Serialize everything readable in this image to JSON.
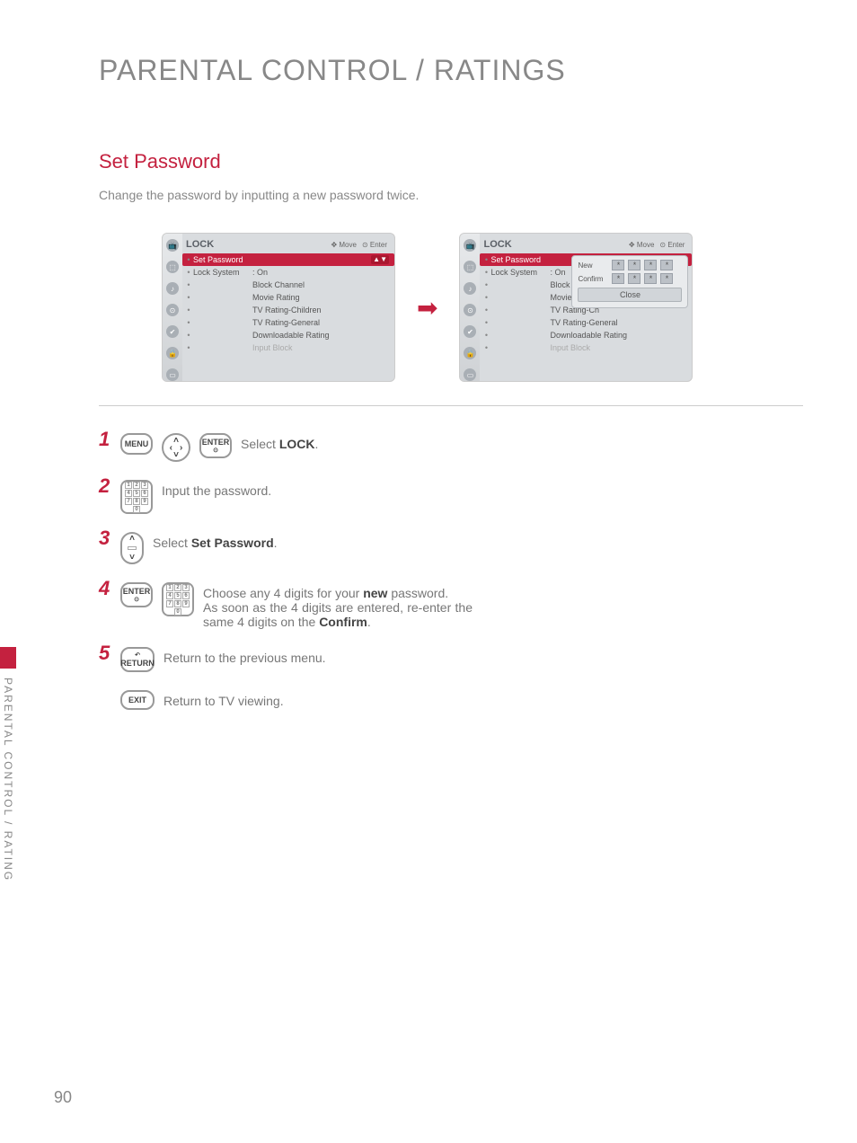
{
  "page": {
    "title": "PARENTAL CONTROL / RATINGS",
    "section_title": "Set Password",
    "section_desc": "Change the password by inputting a new password twice.",
    "number": "90",
    "side_label": "PARENTAL CONTROL / RATING"
  },
  "screen": {
    "header_title": "LOCK",
    "header_move": "Move",
    "header_enter": "Enter",
    "items": {
      "set_password": "Set Password",
      "lock_system_label": "Lock System",
      "lock_system_value": ": On",
      "block_channel": "Block Channel",
      "movie_rating": "Movie Rating",
      "tv_children": "TV Rating-Children",
      "tv_general": "TV Rating-General",
      "downloadable": "Downloadable Rating",
      "input_block": "Input Block"
    },
    "items_trunc": {
      "block_channel": "Block Channe",
      "movie_rating": "Movie Rating",
      "tv_children": "TV Rating-Ch",
      "tv_general": "TV Rating-General"
    },
    "popup": {
      "new": "New",
      "confirm": "Confirm",
      "close": "Close",
      "mask": "*"
    },
    "arrow_glyph": "▲▼"
  },
  "steps": {
    "s1": {
      "num": "1",
      "pre": "Select ",
      "bold": "LOCK",
      "post": "."
    },
    "s2": {
      "num": "2",
      "text": "Input the password."
    },
    "s3": {
      "num": "3",
      "pre": "Select ",
      "bold": "Set Password",
      "post": "."
    },
    "s4": {
      "num": "4",
      "line1_pre": "Choose any 4 digits for your ",
      "line1_bold": "new",
      "line1_post": " password.",
      "line2_pre": "As soon as the 4 digits are entered, re-enter the same 4 digits on the ",
      "line2_bold": "Confirm",
      "line2_post": "."
    },
    "s5": {
      "num": "5",
      "text": "Return to the previous menu."
    },
    "exit": {
      "text": "Return to TV viewing."
    }
  },
  "buttons": {
    "menu": "MENU",
    "enter": "ENTER",
    "enter_sub": "⊙",
    "return": "RETURN",
    "return_sub": "↶",
    "exit": "EXIT",
    "up": "˄",
    "down": "˅",
    "left": "‹",
    "right": "›",
    "move_glyph": "✥",
    "enter_glyph": "⊙"
  }
}
